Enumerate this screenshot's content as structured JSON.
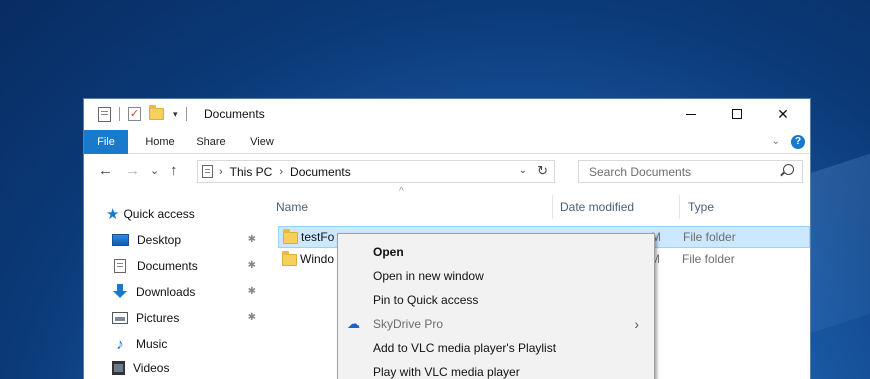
{
  "window": {
    "title": "Documents",
    "minimize_label": "",
    "maximize_label": "",
    "close_label": "✕",
    "qa_dropdown": "▾"
  },
  "ribbon": {
    "tabs": [
      "File",
      "Home",
      "Share",
      "View"
    ],
    "expand_chevron": "⌄",
    "help_label": "?"
  },
  "nav": {
    "back": "←",
    "forward": "→",
    "recent": "⌄",
    "up": "↑",
    "breadcrumb": [
      "This PC",
      "Documents"
    ],
    "breadcrumb_sep": "›",
    "leading_sep": "›",
    "address_dropdown": "⌄",
    "refresh": "↻",
    "search_placeholder": "Search Documents"
  },
  "navpane": {
    "quick_access": "Quick access",
    "items": [
      {
        "label": "Desktop",
        "icon": "desktop-icon",
        "pinned": true
      },
      {
        "label": "Documents",
        "icon": "documents-icon",
        "pinned": true
      },
      {
        "label": "Downloads",
        "icon": "download-icon",
        "pinned": true
      },
      {
        "label": "Pictures",
        "icon": "pictures-icon",
        "pinned": true
      },
      {
        "label": "Music",
        "icon": "music-icon",
        "pinned": false
      },
      {
        "label": "Videos",
        "icon": "videos-icon",
        "pinned": false
      }
    ],
    "pin_glyph": "📌"
  },
  "filelist": {
    "columns": [
      "Name",
      "Date modified",
      "Type"
    ],
    "sort_indicator": "^",
    "rows": [
      {
        "name": "testFo",
        "date_fragment": "M",
        "type": "File folder",
        "selected": true
      },
      {
        "name": "Windo",
        "date_fragment": "M",
        "type": "File folder",
        "selected": false
      }
    ]
  },
  "context_menu": {
    "items": [
      {
        "label": "Open",
        "bold": true,
        "disabled": false,
        "icon": "",
        "submenu": false
      },
      {
        "label": "Open in new window",
        "bold": false,
        "disabled": false,
        "icon": "",
        "submenu": false
      },
      {
        "label": "Pin to Quick access",
        "bold": false,
        "disabled": false,
        "icon": "",
        "submenu": false
      },
      {
        "label": "SkyDrive Pro",
        "bold": false,
        "disabled": true,
        "icon": "skydrive-cloud-icon",
        "submenu": true
      },
      {
        "label": "Add to VLC media player's Playlist",
        "bold": false,
        "disabled": false,
        "icon": "",
        "submenu": false
      },
      {
        "label": "Play with VLC media player",
        "bold": false,
        "disabled": false,
        "icon": "",
        "submenu": false
      }
    ],
    "submenu_arrow": "›",
    "cloud_glyph": "☁"
  },
  "colors": {
    "accent": "#1979ca",
    "selection": "#cce8ff",
    "menu_bg": "#f2f2f2"
  }
}
